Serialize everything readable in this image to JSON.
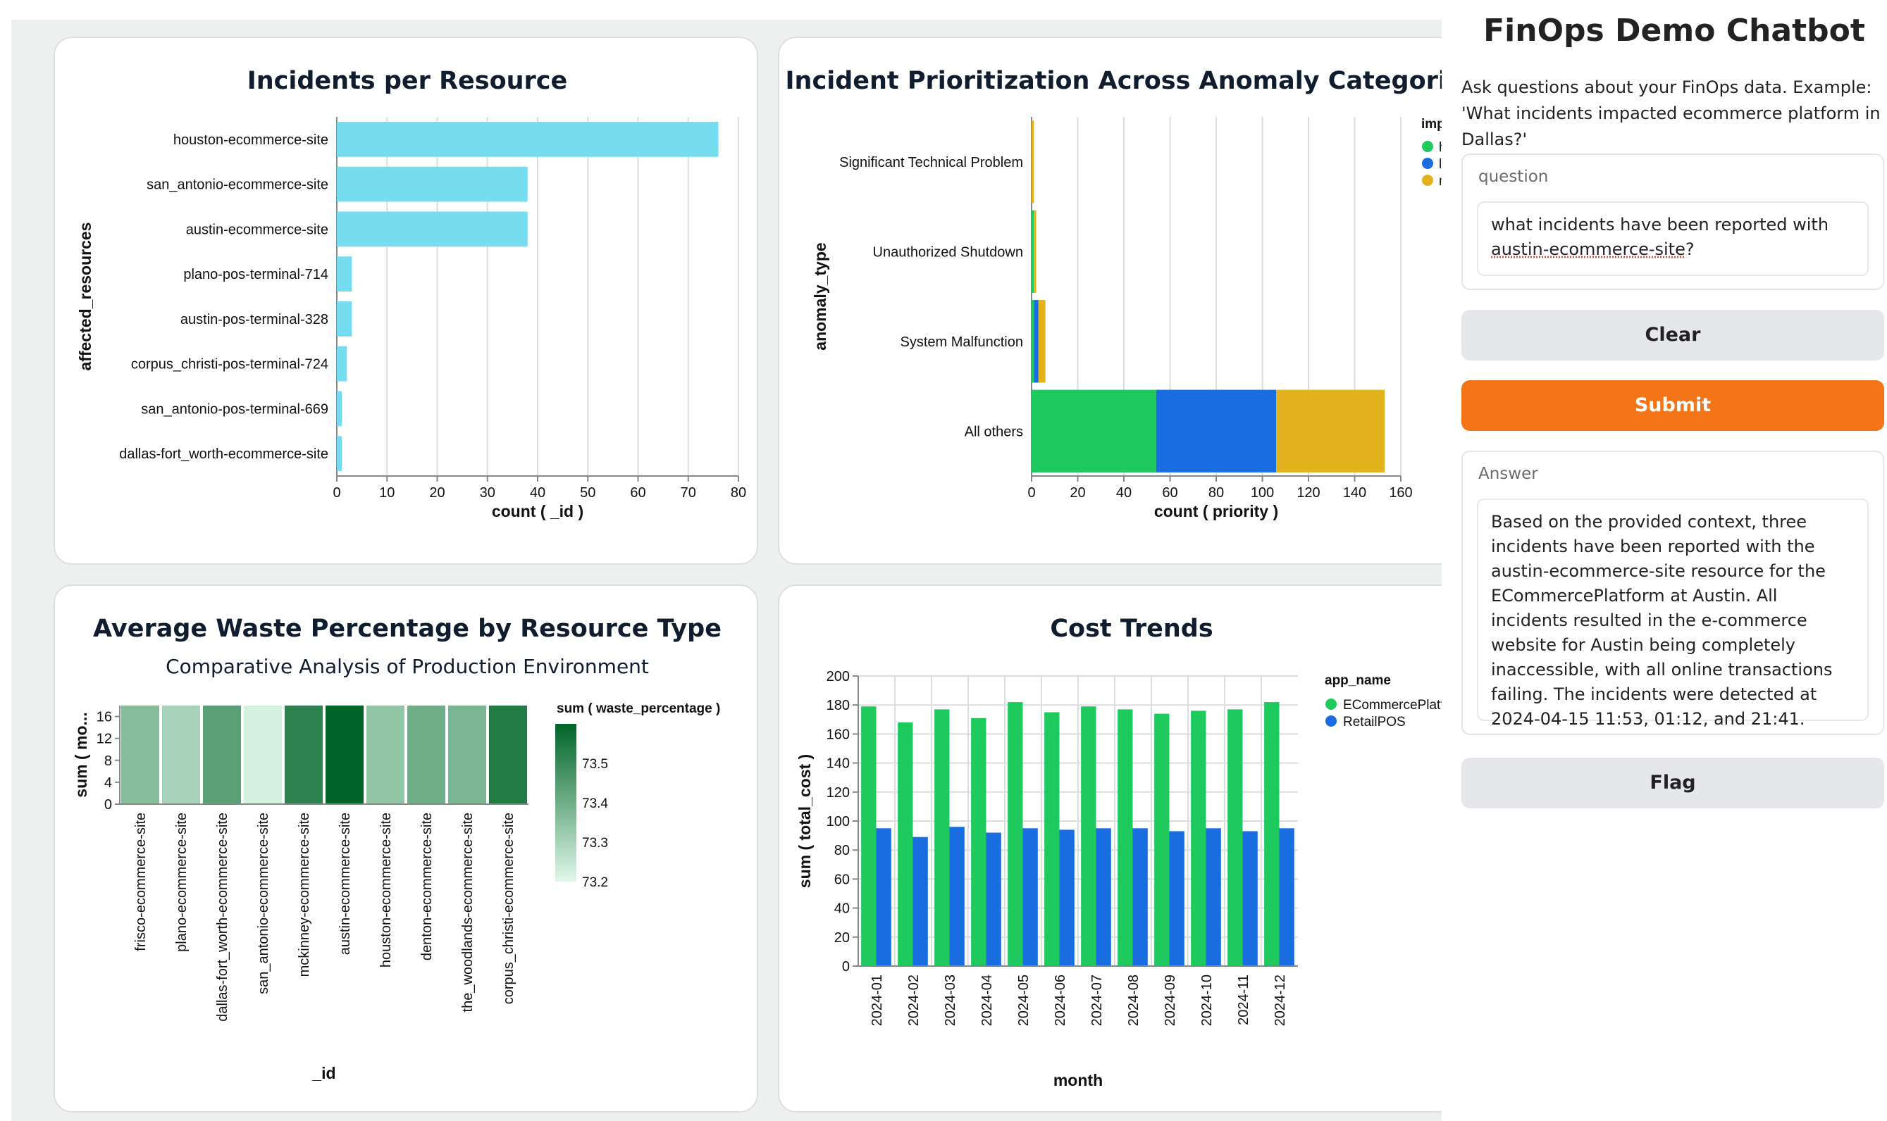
{
  "dashboard": {
    "cards": [
      "Incidents per Resource",
      "Incident Prioritization Across Anomaly Categories",
      "Average Waste Percentage by Resource Type",
      "Cost Trends"
    ]
  },
  "chatbot": {
    "title": "FinOps Demo Chatbot",
    "description": "Ask questions about your FinOps data. Example: 'What incidents impacted ecommerce platform in Dallas?'",
    "question_label": "question",
    "question_value_prefix": "what incidents have been reported with ",
    "question_value_link": "austin-ecommerce-site",
    "question_value_suffix": "?",
    "clear_label": "Clear",
    "submit_label": "Submit",
    "answer_label": "Answer",
    "answer_text": "Based on the provided context, three incidents have been reported with the austin-ecommerce-site resource for the ECommercePlatform at Austin. All incidents resulted in the e-commerce website for Austin being completely inaccessible, with all online transactions failing. The incidents were detected at 2024-04-15 11:53, 01:12, and 21:41.",
    "flag_label": "Flag"
  },
  "chart_data": [
    {
      "type": "bar",
      "orientation": "horizontal",
      "title": "Incidents per Resource",
      "xlabel": "count ( _id )",
      "ylabel": "affected_resources",
      "xlim": [
        0,
        80
      ],
      "xticks": [
        0,
        10,
        20,
        30,
        40,
        50,
        60,
        70,
        80
      ],
      "categories": [
        "houston-ecommerce-site",
        "san_antonio-ecommerce-site",
        "austin-ecommerce-site",
        "plano-pos-terminal-714",
        "austin-pos-terminal-328",
        "corpus_christi-pos-terminal-724",
        "san_antonio-pos-terminal-669",
        "dallas-fort_worth-ecommerce-site"
      ],
      "values": [
        76,
        38,
        38,
        3,
        3,
        2,
        1,
        1
      ],
      "color": "#76dcef",
      "grid": true
    },
    {
      "type": "bar",
      "orientation": "horizontal",
      "stacked": true,
      "title": "Incident Prioritization Across Anomaly Categories",
      "xlabel": "count ( priority )",
      "ylabel": "anomaly_type",
      "xlim": [
        0,
        160
      ],
      "xticks": [
        0,
        20,
        40,
        60,
        80,
        100,
        120,
        140,
        160
      ],
      "categories": [
        "Significant Technical Problem",
        "Unauthorized Shutdown",
        "System Malfunction",
        "All others"
      ],
      "series": [
        {
          "name": "high",
          "color": "#1ec95e",
          "values": [
            0,
            1,
            1,
            54
          ]
        },
        {
          "name": "low",
          "color": "#1a6de0",
          "values": [
            0,
            0,
            2,
            52
          ]
        },
        {
          "name": "medi",
          "color": "#e2b21d",
          "values": [
            1,
            1,
            3,
            47
          ]
        }
      ],
      "legend_title": "impact",
      "legend": "top-right",
      "grid": true
    },
    {
      "type": "heatmap",
      "title": "Average Waste Percentage by Resource Type",
      "subtitle": "Comparative Analysis of Production Environment",
      "xlabel": "_id",
      "ylabel": "sum ( mo...",
      "yticks": [
        0,
        4,
        8,
        12,
        16
      ],
      "categories": [
        "frisco-ecommerce-site",
        "plano-ecommerce-site",
        "dallas-fort_worth-ecommerce-site",
        "san_antonio-ecommerce-site",
        "mckinney-ecommerce-site",
        "austin-ecommerce-site",
        "houston-ecommerce-site",
        "denton-ecommerce-site",
        "the_woodlands-ecommerce-site",
        "corpus_christi-ecommerce-site"
      ],
      "values": [
        73.36,
        73.3,
        73.44,
        73.22,
        73.52,
        73.6,
        73.34,
        73.4,
        73.38,
        73.54
      ],
      "legend_title": "sum ( waste_percentage )",
      "color_scale_range": [
        73.2,
        73.6
      ],
      "color_scale_ticks": [
        73.2,
        73.3,
        73.4,
        73.5
      ]
    },
    {
      "type": "bar",
      "grouped": true,
      "title": "Cost Trends",
      "xlabel": "month",
      "ylabel": "sum ( total_cost )",
      "ylim": [
        0,
        200
      ],
      "yticks": [
        0,
        20,
        40,
        60,
        80,
        100,
        120,
        140,
        160,
        180,
        200
      ],
      "categories": [
        "2024-01",
        "2024-02",
        "2024-03",
        "2024-04",
        "2024-05",
        "2024-06",
        "2024-07",
        "2024-08",
        "2024-09",
        "2024-10",
        "2024-11",
        "2024-12"
      ],
      "series": [
        {
          "name": "ECommercePlatfc",
          "color": "#1ec95e",
          "values": [
            179,
            168,
            177,
            171,
            182,
            175,
            179,
            177,
            174,
            176,
            177,
            182
          ]
        },
        {
          "name": "RetailPOS",
          "color": "#1a6de0",
          "values": [
            95,
            89,
            96,
            92,
            95,
            94,
            95,
            95,
            93,
            95,
            93,
            95
          ]
        }
      ],
      "legend_title": "app_name",
      "legend": "top-right",
      "grid": true
    }
  ]
}
